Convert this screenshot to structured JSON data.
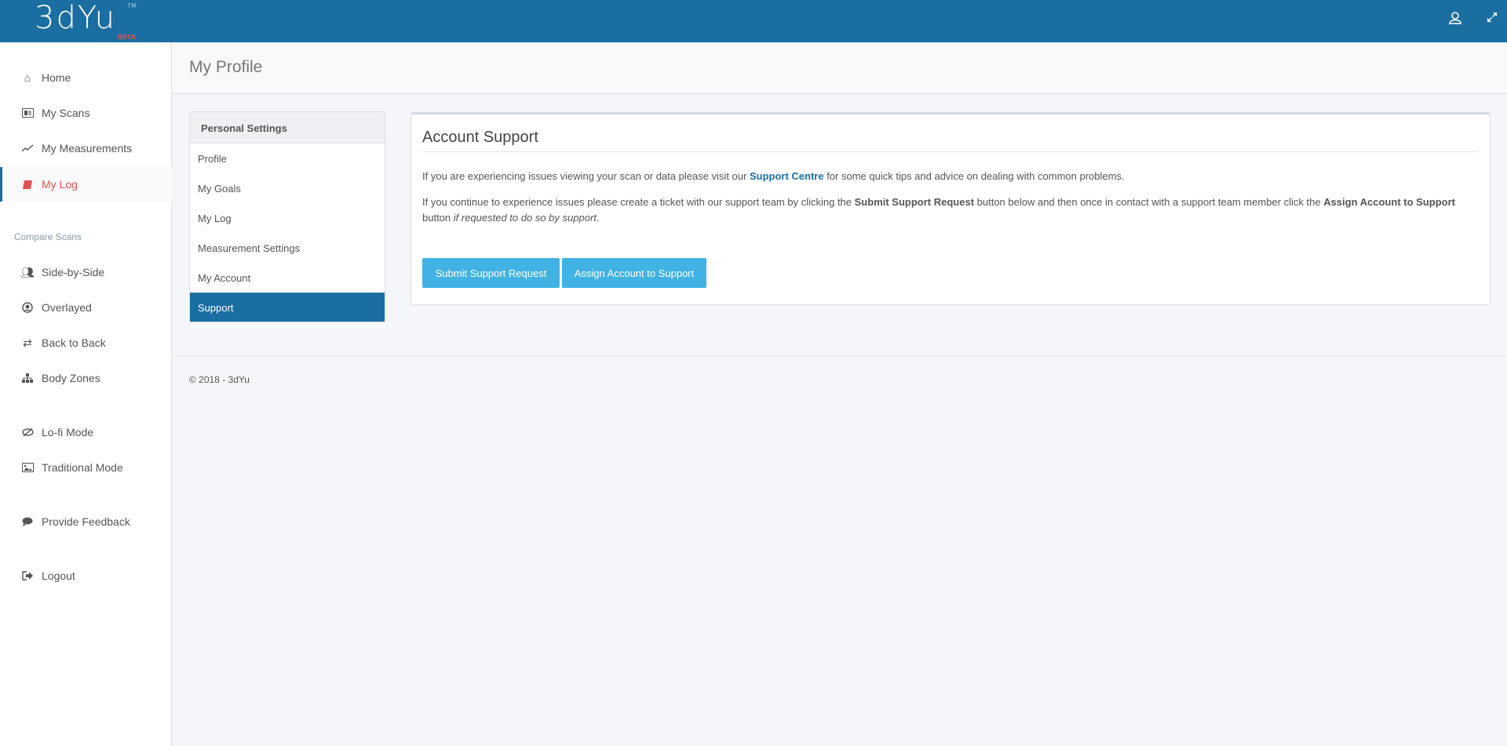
{
  "header": {
    "logo_text": "3dYu",
    "logo_tm": "TM",
    "logo_badge": "BETA"
  },
  "sidebar": {
    "items": [
      {
        "label": "Home",
        "icon": "home-icon"
      },
      {
        "label": "My Scans",
        "icon": "id-card-icon"
      },
      {
        "label": "My Measurements",
        "icon": "line-chart-icon"
      },
      {
        "label": "My Log",
        "icon": "book-icon",
        "active": true
      }
    ],
    "compare_heading": "Compare Scans",
    "compare_items": [
      {
        "label": "Side-by-Side",
        "icon": "users-icon"
      },
      {
        "label": "Overlayed",
        "icon": "user-circle-icon"
      },
      {
        "label": "Back to Back",
        "icon": "exchange-icon"
      },
      {
        "label": "Body Zones",
        "icon": "sitemap-icon"
      }
    ],
    "mode_items": [
      {
        "label": "Lo-fi Mode",
        "icon": "eye-slash-icon"
      },
      {
        "label": "Traditional Mode",
        "icon": "image-icon"
      }
    ],
    "feedback": "Provide Feedback",
    "logout": "Logout"
  },
  "page": {
    "title": "My Profile"
  },
  "settings": {
    "heading": "Personal Settings",
    "items": [
      "Profile",
      "My Goals",
      "My Log",
      "Measurement Settings",
      "My Account",
      "Support"
    ],
    "active": "Support"
  },
  "support": {
    "title": "Account Support",
    "p1_pre": "If you are experiencing issues viewing your scan or data please visit our ",
    "p1_link": "Support Centre",
    "p1_post": " for some quick tips and advice on dealing with common problems.",
    "p2_a": "If you continue to experience issues please create a ticket with our support team by clicking the ",
    "p2_b": "Submit Support Request",
    "p2_c": " button below and then once in contact with a support team member click the ",
    "p2_d": "Assign Account to Support",
    "p2_e": " button ",
    "p2_f": "if requested to do so by support",
    "p2_g": ".",
    "submit_button": "Submit Support Request",
    "assign_button": "Assign Account to Support"
  },
  "footer": {
    "text": "© 2018 - 3dYu"
  },
  "colors": {
    "brand": "#1b6ea1",
    "button": "#41b2e4",
    "active_nav": "#e05050"
  }
}
